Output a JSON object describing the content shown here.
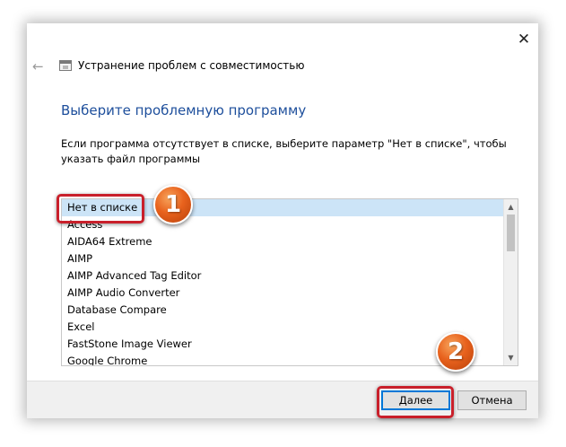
{
  "window": {
    "title": "Устранение проблем с совместимостью",
    "close_glyph": "✕",
    "back_glyph": "←"
  },
  "heading": "Выберите проблемную программу",
  "description": "Если программа отсутствует в списке, выберите параметр \"Нет в списке\", чтобы указать файл программы",
  "list": {
    "items": [
      "Нет в списке",
      "Access",
      "AIDA64 Extreme",
      "AIMP",
      "AIMP Advanced Tag Editor",
      "AIMP Audio Converter",
      "Database Compare",
      "Excel",
      "FastStone Image Viewer",
      "Google Chrome"
    ],
    "selected_index": 0,
    "selection_color": "#cce4f7"
  },
  "scrollbar": {
    "up_glyph": "▲",
    "down_glyph": "▼"
  },
  "buttons": {
    "next_label": "Далее",
    "cancel_label": "Отмена"
  },
  "annotations": {
    "badge1": "1",
    "badge2": "2",
    "highlight_color": "#c9202b"
  },
  "icons": {
    "close": "close-icon",
    "back": "back-arrow-icon",
    "app": "troubleshooter-window-icon"
  }
}
